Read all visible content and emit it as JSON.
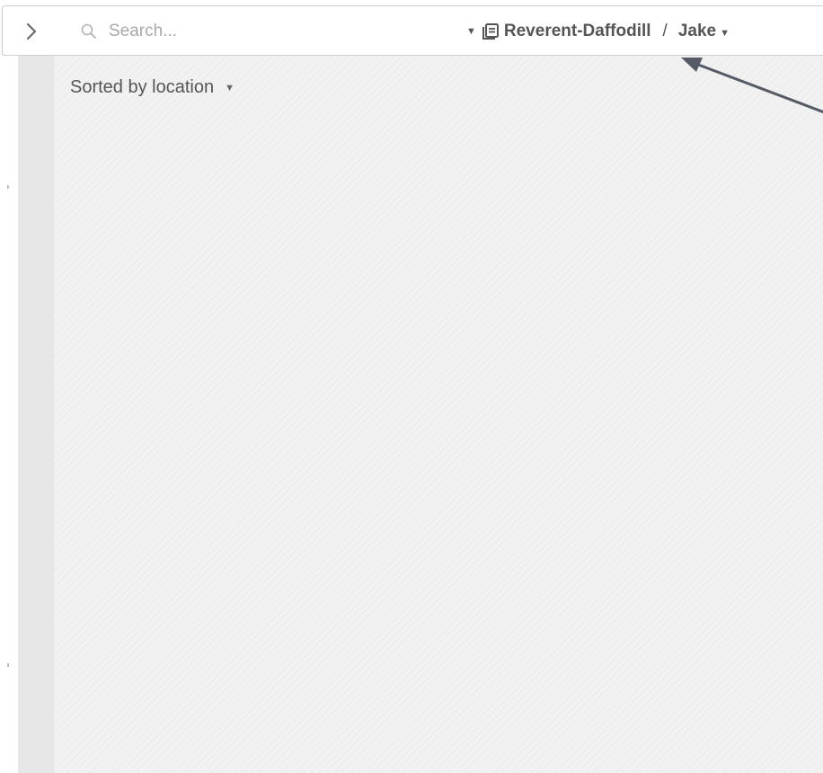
{
  "toolbar": {
    "search": {
      "placeholder": "Search...",
      "value": ""
    },
    "breadcrumb": {
      "library_name": "Reverent-Daffodill",
      "separator": "/",
      "user_name": "Jake"
    }
  },
  "main": {
    "sort_label": "Sorted by location"
  },
  "colors": {
    "rail": "#e6e6e6",
    "content_bg": "#f3f3f3",
    "text": "#555555",
    "annotation_arrow": "#555b66"
  },
  "icons": {
    "expand": "chevron-right-icon",
    "search": "search-icon",
    "library": "library-icon",
    "caret": "caret-down-icon"
  }
}
